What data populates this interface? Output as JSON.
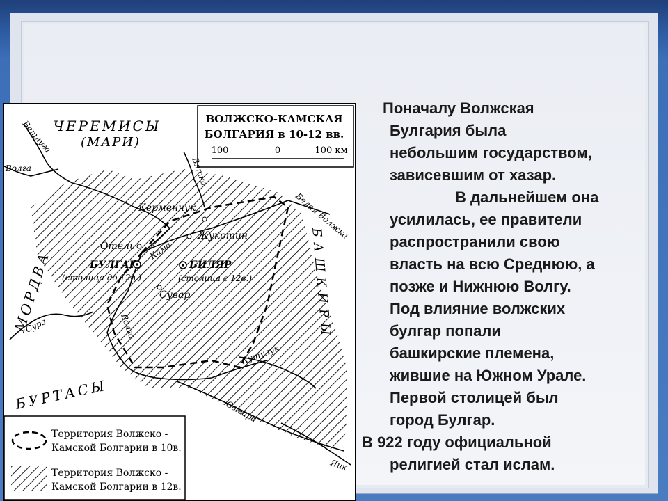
{
  "map": {
    "title_line1": "ВОЛЖСКО-КАМСКАЯ",
    "title_line2": "БОЛГАРИЯ в 10-12 вв.",
    "scale_left": "100",
    "scale_mid": "0",
    "scale_right": "100 км",
    "regions": {
      "cheremisy": "ЧЕРЕМИСЫ",
      "mari": "(МАРИ)",
      "mordva": "МОРДВА",
      "burtasy": "БУРТАСЫ",
      "bashkiry": "БАШКИРЫ"
    },
    "rivers": {
      "vetluga": "Ветлуга",
      "volga_top": "Волга",
      "vyatka": "Вятка",
      "belaya_volzhka": "Белая Волжка",
      "kama": "Кама",
      "volga": "Волга",
      "sura": "Сура",
      "kutuluk": "Кутулук",
      "samara": "Самара",
      "yaik": "Яик"
    },
    "cities": {
      "kermenchuk": "Керменчук",
      "zhukotin": "Жукотин",
      "otel": "Отель",
      "bulgar": "БУЛГАР",
      "bulgar_note": "(столица до 12в.)",
      "bilyar": "БИЛЯР",
      "bilyar_note": "(столица с 12в.)",
      "suvar": "Сувар"
    },
    "legend": [
      {
        "line1": "Территория Волжско -",
        "line2": "Камской Болгарии в 10в."
      },
      {
        "line1": "Территория Волжско -",
        "line2": "Камской Болгарии в 12в."
      }
    ]
  },
  "text": {
    "p1": [
      "Поначалу Волжская",
      "Булгария  была",
      "небольшим государством,",
      "зависевшим от хазар."
    ],
    "p2_first": "В дальнейшем она",
    "p2": [
      "усилилась, ее правители",
      "распространили свою",
      "власть на всю Среднюю, а",
      "позже и Нижнюю Волгу.",
      "Под влияние волжских",
      "булгар попали",
      "башкирские племена,",
      "жившие на Южном Урале.",
      "Первой столицей был",
      "город Булгар."
    ],
    "p3_first": "В 922 году официальной",
    "p3_second": "религией стал ислам."
  },
  "colors": {
    "header_blue": "#2c5aa0",
    "panel": "#eaedf3",
    "text": "#1a1a1a"
  }
}
